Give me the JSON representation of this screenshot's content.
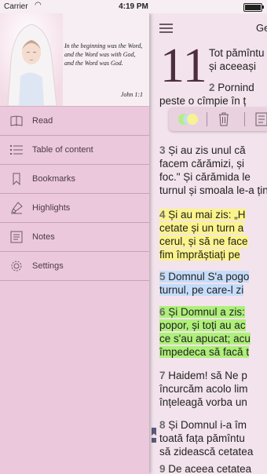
{
  "status": {
    "carrier": "Carrier",
    "time": "4:19 PM"
  },
  "sidebar": {
    "quote": "In the beginning was the Word, and the Word was with God, and the Word was God.",
    "quote_ref": "John 1:1",
    "items": [
      {
        "label": "Read",
        "icon": "book-icon"
      },
      {
        "label": "Table of content",
        "icon": "list-icon"
      },
      {
        "label": "Bookmarks",
        "icon": "bookmark-icon"
      },
      {
        "label": "Highlights",
        "icon": "highlighter-icon"
      },
      {
        "label": "Notes",
        "icon": "notes-icon"
      },
      {
        "label": "Settings",
        "icon": "gear-icon"
      }
    ]
  },
  "reader": {
    "book_title": "Ge",
    "chapter": "11",
    "lines": {
      "l1a": "Tot pămîntu",
      "l1b": "și aceeași",
      "v2n": "2",
      "l2a": "Pornind",
      "l2b": "peste o cîmpie în ț",
      "v3n": "3",
      "l3a": "Și au zis unul că",
      "l3b": "facem cărămizi, și",
      "l3c": "foc.\" Și cărămida le",
      "l3d": "turnul și smoala le-a ținut",
      "v4n": "4",
      "l4a": "Și au mai zis: „H",
      "l4b": "cetate și un turn a",
      "l4c": "cerul, și să ne face",
      "l4d": "fim împrăștiați pe",
      "v5n": "5",
      "l5a": "Domnul S'a pogo",
      "l5b": "turnul, pe care-l zi",
      "v6n": "6",
      "l6a": "Și Domnul a zis:",
      "l6b": "popor, și toți au ac",
      "l6c": "ce s'au apucat; acu",
      "l6d": "împedeca să facă t",
      "v7n": "7",
      "l7a": "Haidem! să Ne p",
      "l7b": "încurcăm acolo lim",
      "l7c": "înțeleagă vorba un",
      "v8n": "8",
      "l8a": "Și Domnul i-a îm",
      "l8b": "toată fața pămîntu",
      "l8c": "să zidească cetatea",
      "v9n": "9",
      "l9a": "De aceea cetatea"
    }
  },
  "colors": {
    "sidebar_bg": "#ecc8dc",
    "reader_bg": "#f3e3ec",
    "highlight_yellow": "#fcf48a",
    "highlight_blue": "#c5dcfa",
    "highlight_green": "#aef07a"
  }
}
